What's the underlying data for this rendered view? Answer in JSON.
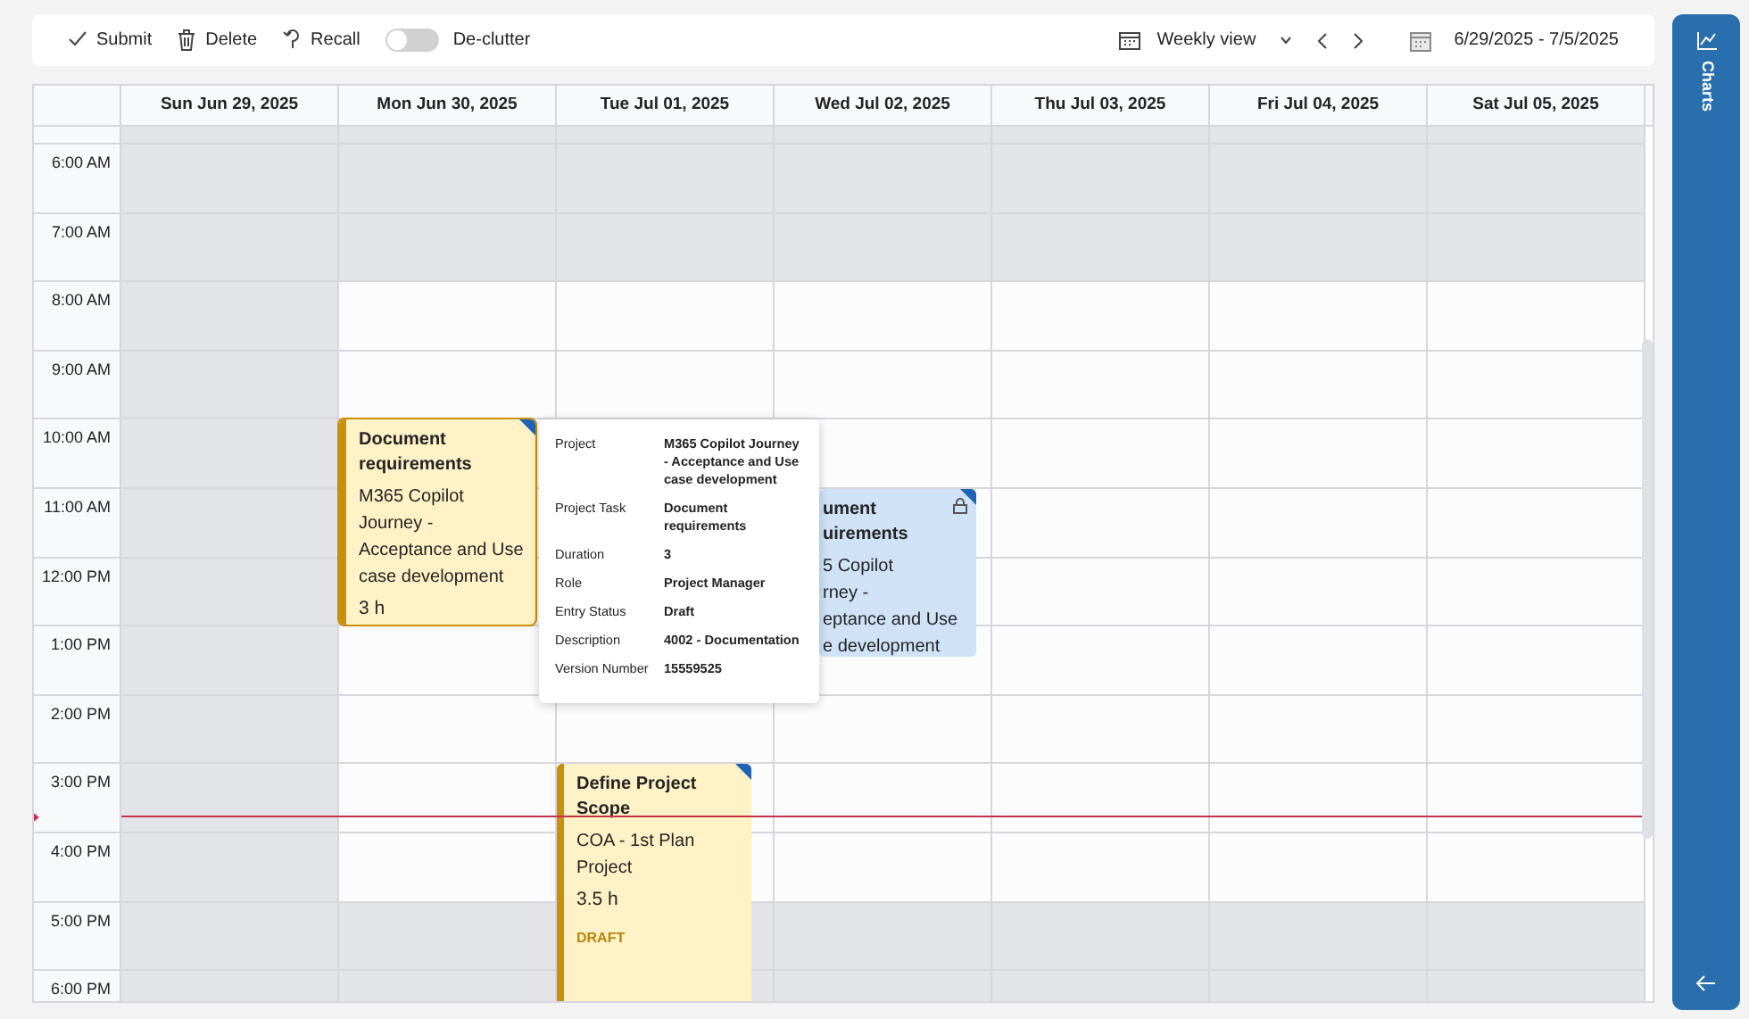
{
  "toolbar": {
    "actions": [
      {
        "kind": "submit",
        "label": "Submit"
      },
      {
        "kind": "delete",
        "label": "Delete"
      },
      {
        "kind": "recall",
        "label": "Recall"
      }
    ],
    "declutter": {
      "label": "De-clutter",
      "on": false
    },
    "view": {
      "label": "Weekly view"
    },
    "date_range": "6/29/2025 - 7/5/2025"
  },
  "calendar": {
    "days": [
      {
        "label": "Sun Jun 29, 2025"
      },
      {
        "label": "Mon Jun 30, 2025"
      },
      {
        "label": "Tue Jul 01, 2025"
      },
      {
        "label": "Wed Jul 02, 2025"
      },
      {
        "label": "Thu Jul 03, 2025"
      },
      {
        "label": "Fri Jul 04, 2025"
      },
      {
        "label": "Sat Jul 05, 2025"
      }
    ],
    "hours": [
      {
        "label": "6:00 AM",
        "working": [
          false,
          false,
          false,
          false,
          false,
          false,
          false
        ]
      },
      {
        "label": "7:00 AM",
        "working": [
          false,
          false,
          false,
          false,
          false,
          false,
          false
        ]
      },
      {
        "label": "8:00 AM",
        "working": [
          false,
          true,
          true,
          true,
          true,
          true,
          true
        ]
      },
      {
        "label": "9:00 AM",
        "working": [
          false,
          true,
          true,
          true,
          true,
          true,
          true
        ]
      },
      {
        "label": "10:00 AM",
        "cells": [
          {
            "working": false
          },
          {
            "working": true
          },
          {},
          {
            "working": true
          },
          {
            "working": true
          },
          {
            "working": true
          },
          {
            "working": true
          }
        ]
      },
      {
        "label": "11:00 AM",
        "cells": [
          {
            "working": false
          },
          {
            "working": true
          },
          {},
          {
            "working": true
          },
          {
            "working": true
          },
          {
            "working": true
          },
          {
            "working": true
          }
        ]
      },
      {
        "label": "12:00 PM",
        "cells": [
          {
            "working": false
          },
          {
            "working": true
          },
          {},
          {
            "working": true
          },
          {
            "working": true
          },
          {
            "working": true
          },
          {
            "working": true
          }
        ]
      },
      {
        "label": "1:00 PM",
        "cells": [
          {
            "working": false
          },
          {
            "working": true
          },
          {},
          {
            "working": true
          },
          {
            "working": true
          },
          {
            "working": true
          },
          {
            "working": true
          }
        ]
      },
      {
        "label": "2:00 PM",
        "working": [
          false,
          true,
          true,
          true,
          true,
          true,
          true
        ]
      },
      {
        "label": "3:00 PM",
        "working": [
          false,
          true,
          true,
          true,
          true,
          true,
          true
        ]
      },
      {
        "label": "4:00 PM",
        "working": [
          false,
          true,
          true,
          true,
          true,
          true,
          true
        ]
      },
      {
        "label": "5:00 PM",
        "working": [
          false,
          false,
          false,
          false,
          false,
          false,
          false
        ]
      },
      {
        "label": "6:00 PM",
        "working": [
          false,
          false,
          false,
          false,
          false,
          false,
          false
        ]
      }
    ],
    "events": [
      {
        "title_lines": [
          "Document",
          "requirements"
        ],
        "body_lines": [
          "M365 Copilot",
          "Journey -",
          "Acceptance and Use",
          "case development"
        ],
        "duration": "3 h",
        "color": "#fff2c6",
        "selected": true,
        "locked": false
      },
      {
        "title_lines": [
          "ument",
          "uirements"
        ],
        "body_lines": [
          "5 Copilot",
          "rney -",
          "eptance and Use",
          "e development"
        ],
        "color": "#cfe2f7",
        "selected": false,
        "locked": true
      },
      {
        "title_lines": [
          "Define Project",
          "Scope"
        ],
        "body_lines": [
          "COA - 1st Plan",
          "Project"
        ],
        "duration": "3.5 h",
        "status": "DRAFT",
        "color": "#fff2c6",
        "selected": false,
        "locked": false
      }
    ],
    "tooltip": [
      {
        "label": "Project",
        "value": "M365 Copilot Journey - Acceptance and Use case development"
      },
      {
        "label": "Project Task",
        "value": "Document requirements"
      },
      {
        "label": "Duration",
        "value": "3"
      },
      {
        "label": "Role",
        "value": "Project Manager"
      },
      {
        "label": "Entry Status",
        "value": "Draft"
      },
      {
        "label": "Description",
        "value": "4002 - Documentation"
      },
      {
        "label": "Version Number",
        "value": "15559525"
      }
    ]
  },
  "side_panel": {
    "label": "Charts"
  }
}
